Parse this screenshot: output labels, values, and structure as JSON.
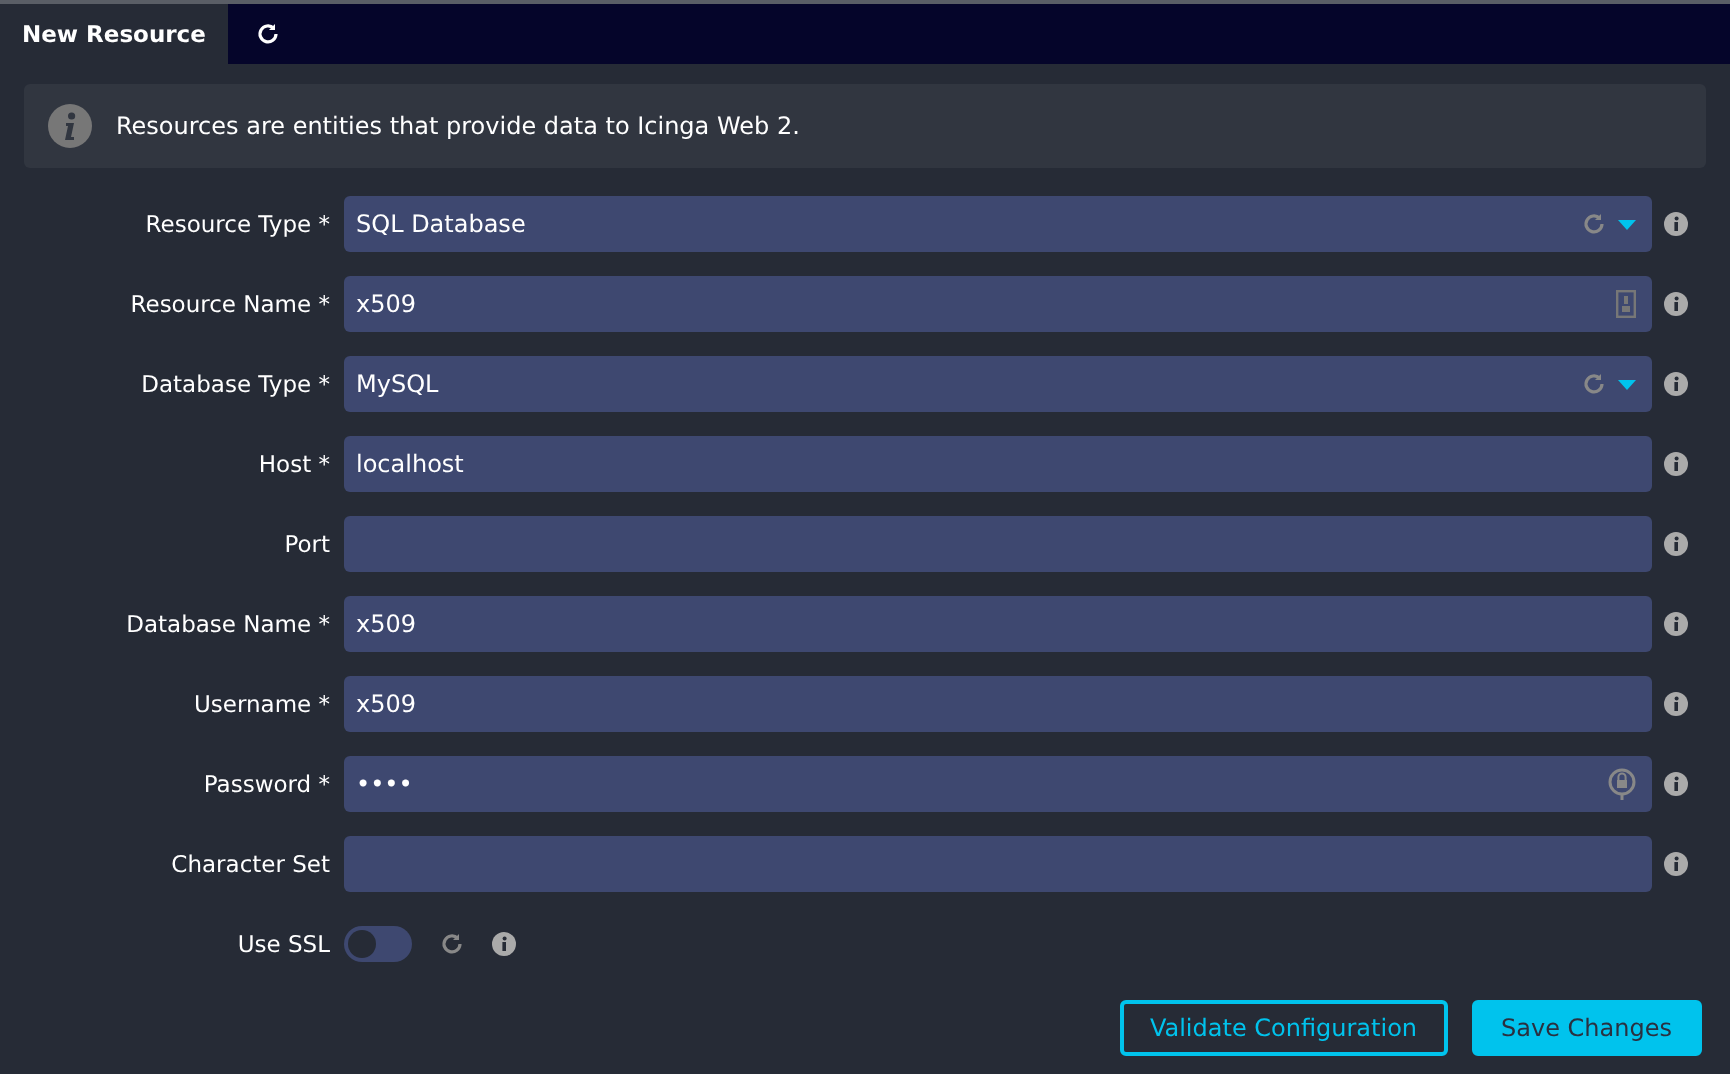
{
  "tabs": [
    {
      "label": "New Resource",
      "selected": true
    },
    {
      "kind": "refresh",
      "selected": false
    }
  ],
  "notice": "Resources are entities that provide data to Icinga Web 2.",
  "fields": [
    {
      "label": "Resource Type *",
      "kind": "select",
      "value": "SQL Database"
    },
    {
      "label": "Resource Name *",
      "kind": "text-badge",
      "value": "x509"
    },
    {
      "label": "Database Type *",
      "kind": "select",
      "value": "MySQL"
    },
    {
      "label": "Host *",
      "kind": "text",
      "value": "localhost"
    },
    {
      "label": "Port",
      "kind": "text"
    },
    {
      "label": "Database Name *",
      "kind": "text",
      "value": "x509"
    },
    {
      "label": "Username *",
      "kind": "text",
      "value": "x509"
    },
    {
      "label": "Password *",
      "kind": "password",
      "value": "••••"
    },
    {
      "label": "Character Set",
      "kind": "text"
    }
  ],
  "use_ssl": {
    "label": "Use SSL",
    "on": false
  },
  "buttons": [
    {
      "label": "Validate Configuration",
      "kind": "outline"
    },
    {
      "label": "Save Changes",
      "kind": "primary"
    }
  ]
}
